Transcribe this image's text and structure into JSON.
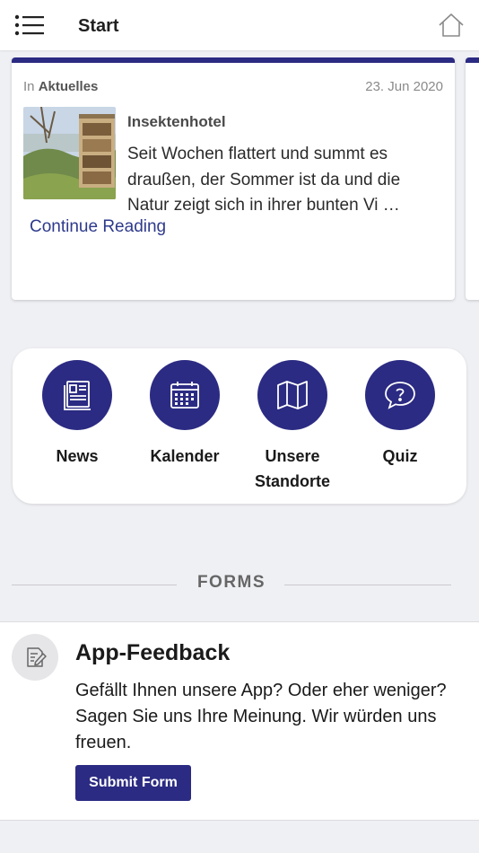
{
  "header": {
    "title": "Start",
    "menu_icon": "menu-list-icon",
    "home_icon": "home-icon"
  },
  "news_card": {
    "category_prefix": "In",
    "category": "Aktuelles",
    "date": "23. Jun 2020",
    "title": "Insektenhotel",
    "excerpt": "Seit Wochen flattert und summt es draußen, der Sommer ist da und die Natur zeigt sich in ihrer bunten Vi …",
    "continue_label": "Continue Reading"
  },
  "quick_links": [
    {
      "label": "News",
      "icon": "newspaper-icon"
    },
    {
      "label": "Kalender",
      "icon": "calendar-icon"
    },
    {
      "label": "Unsere Standorte",
      "icon": "map-icon"
    },
    {
      "label": "Quiz",
      "icon": "question-bubble-icon"
    }
  ],
  "forms_section": {
    "title": "FORMS"
  },
  "form_card": {
    "title": "App-Feedback",
    "description": "Gefällt Ihnen unsere App? Oder eher weniger? Sagen Sie uns Ihre Meinung. Wir würden uns freuen.",
    "button_label": "Submit Form",
    "icon": "form-edit-icon"
  },
  "colors": {
    "accent": "#2b2b83",
    "link": "#2e3a8c",
    "background": "#eff0f4"
  }
}
